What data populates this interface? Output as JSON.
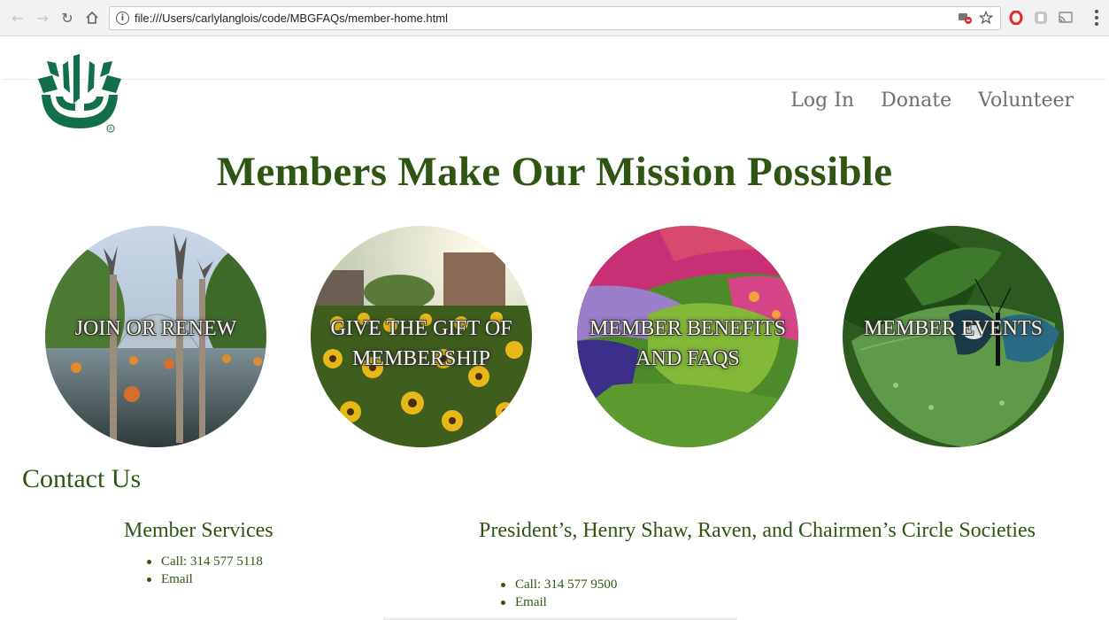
{
  "browser": {
    "url": "file:///Users/carlylanglois/code/MBGFAQs/member-home.html",
    "info_glyph": "i"
  },
  "colors": {
    "brand_green": "#2e5512",
    "logo_green": "#11704a",
    "nav_gray": "#6e6e6e"
  },
  "nav": {
    "items": [
      {
        "label": "Log In"
      },
      {
        "label": "Donate"
      },
      {
        "label": "Volunteer"
      }
    ]
  },
  "hero": {
    "title": "Members Make Our Mission Possible"
  },
  "tiles": [
    {
      "label": "JOIN OR RENEW",
      "image": "glass-sculptures-reflecting-pool"
    },
    {
      "label": "GIVE THE GIFT OF MEMBERSHIP",
      "image": "sunflower-field"
    },
    {
      "label": "MEMBER BENEFITS AND FAQS",
      "image": "flower-beds"
    },
    {
      "label": "MEMBER EVENTS",
      "image": "butterfly-on-leaf"
    }
  ],
  "contact": {
    "title": "Contact Us",
    "sections": [
      {
        "heading": "Member Services",
        "items": [
          "Call: 314 577 5118",
          "Email"
        ]
      },
      {
        "heading": "President’s, Henry Shaw, Raven, and Chairmen’s Circle Societies",
        "items": [
          "Call: 314 577 9500",
          "Email"
        ]
      }
    ]
  }
}
